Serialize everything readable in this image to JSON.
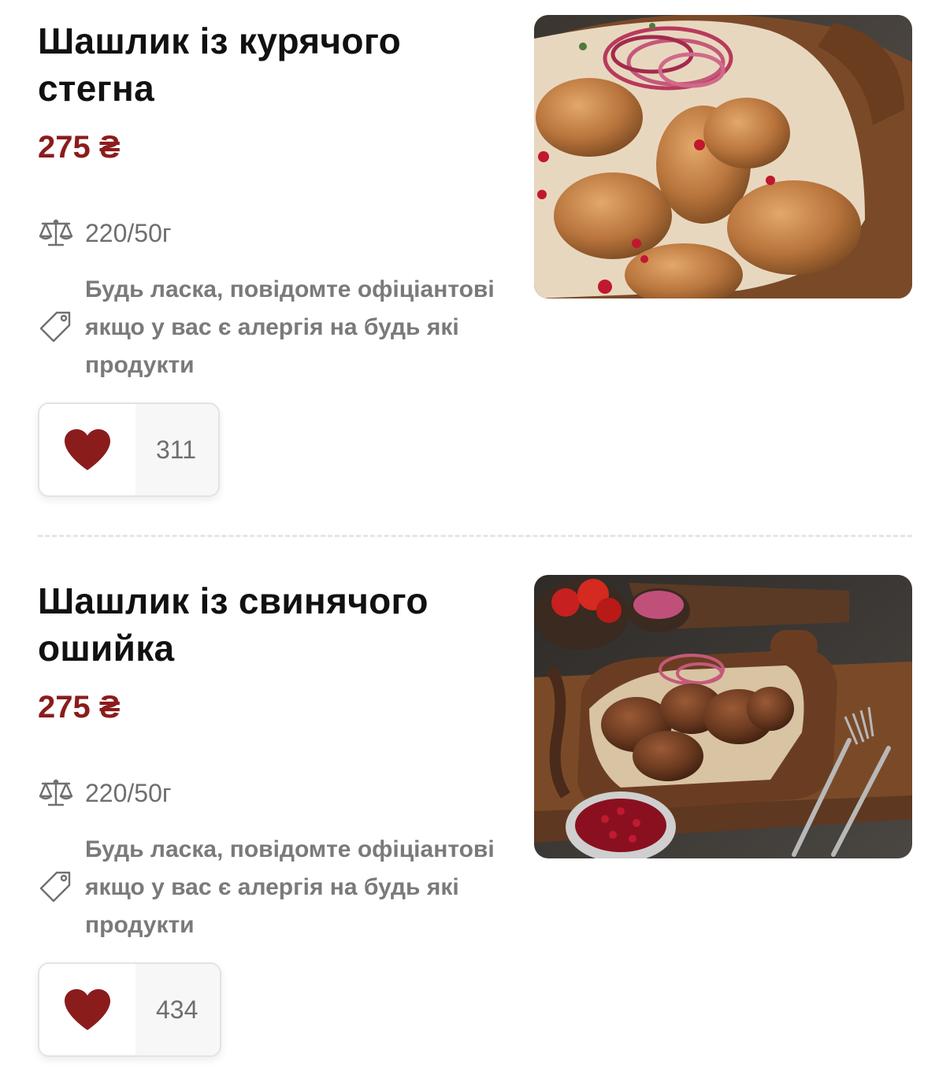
{
  "items": [
    {
      "title": "Шашлик із курячого стегна",
      "price": "275 ₴",
      "weight": "220/50г",
      "allergy_note": "Будь ласка, повідомте офіціантові якщо у вас є алергія на будь які продукти",
      "likes": "311"
    },
    {
      "title": "Шашлик із свинячого ошийка",
      "price": "275 ₴",
      "weight": "220/50г",
      "allergy_note": "Будь ласка, повідомте офіціантові якщо у вас є алергія на будь які продукти",
      "likes": "434"
    }
  ],
  "colors": {
    "accent": "#8b1c1c",
    "muted_text": "#6e6e6e"
  },
  "icons": [
    "scales-icon",
    "tag-icon",
    "heart-icon"
  ]
}
